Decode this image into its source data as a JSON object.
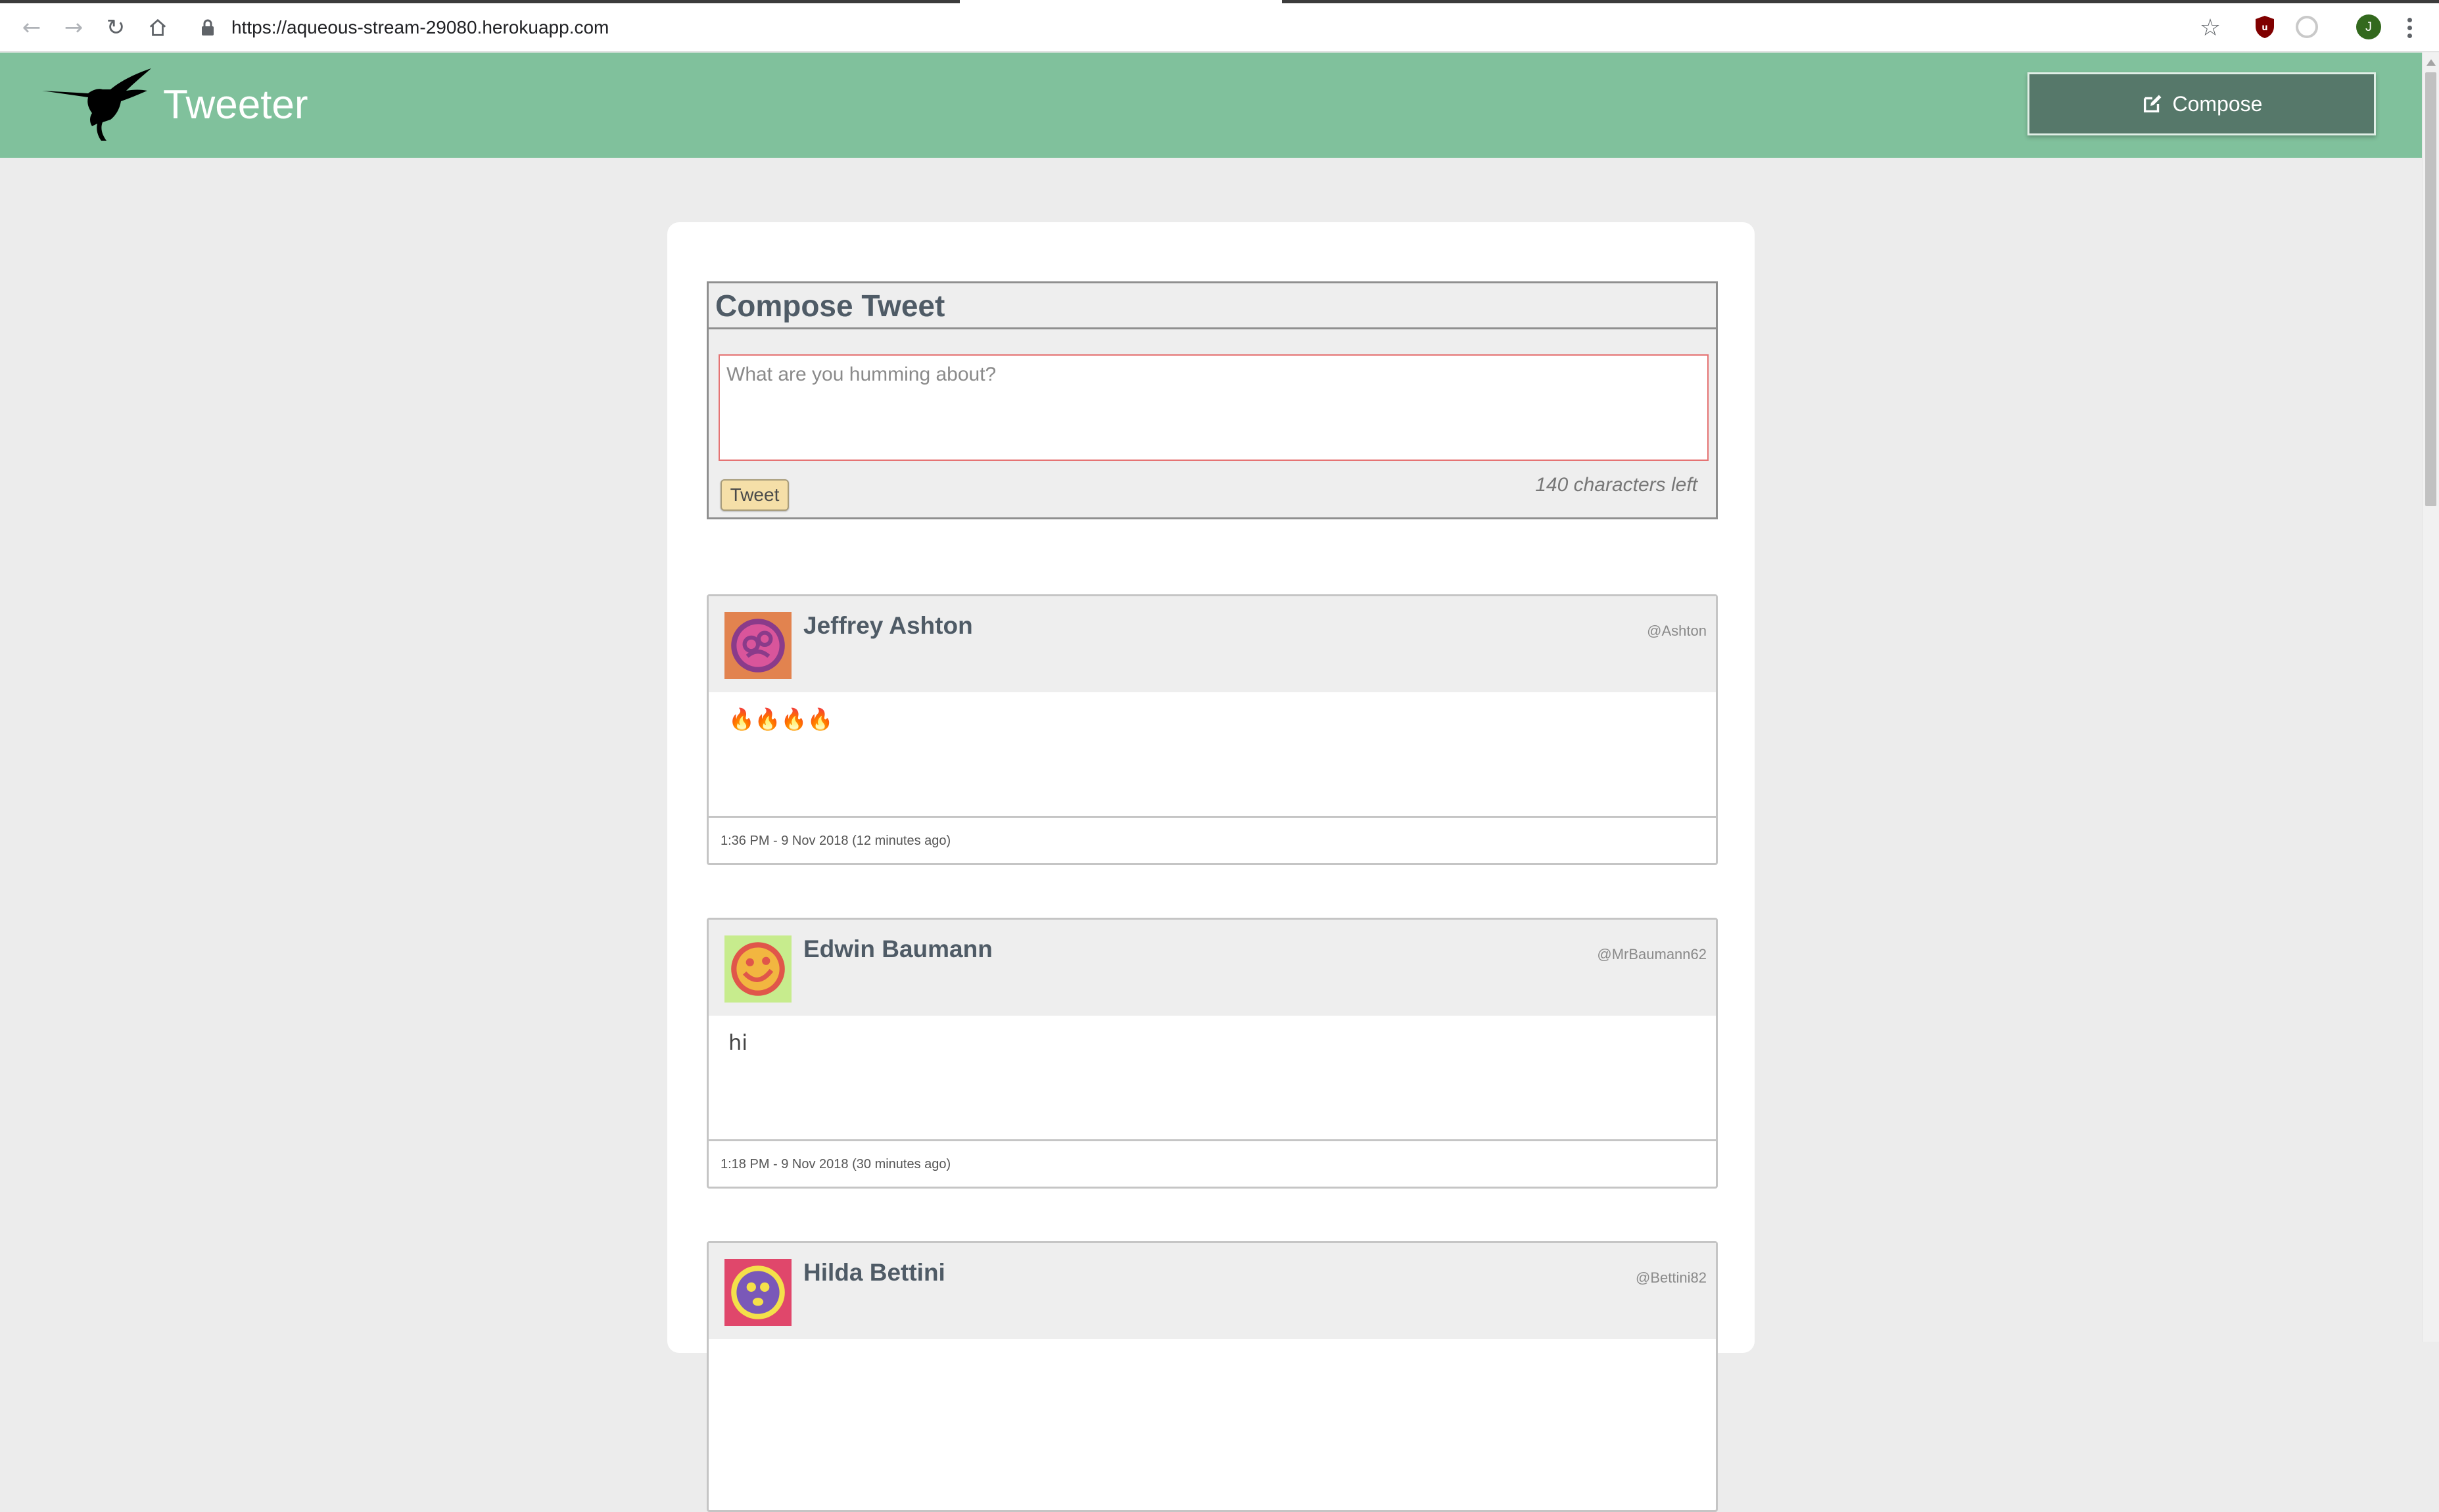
{
  "browser": {
    "url": "https://aqueous-stream-29080.herokuapp.com",
    "profile_initial": "J",
    "back_icon": "arrow-left-icon",
    "forward_icon": "arrow-right-icon",
    "reload_icon": "reload-icon",
    "home_icon": "home-icon"
  },
  "header": {
    "title": "Tweeter",
    "compose_label": "Compose",
    "color": "#80c19c",
    "compose_button_color": "#56786a"
  },
  "compose": {
    "heading": "Compose Tweet",
    "placeholder": "What are you humming about?",
    "tweet_button": "Tweet",
    "counter": "140 characters left"
  },
  "tweets": [
    {
      "name": "Jeffrey Ashton",
      "handle": "@Ashton",
      "content": "🔥🔥🔥🔥",
      "time": "1:36 PM - 9 Nov 2018 (12 minutes ago)",
      "avatar_bg": "#e2834f",
      "avatar_fg": "#8a3b8a"
    },
    {
      "name": "Edwin Baumann",
      "handle": "@MrBaumann62",
      "content": "hi",
      "time": "1:18 PM - 9 Nov 2018 (30 minutes ago)",
      "avatar_bg": "#c7ec8d",
      "avatar_fg": "#e0564a"
    },
    {
      "name": "Hilda Bettini",
      "handle": "@Bettini82",
      "avatar_bg": "#e0476b",
      "avatar_fg": "#f4e04a"
    }
  ]
}
